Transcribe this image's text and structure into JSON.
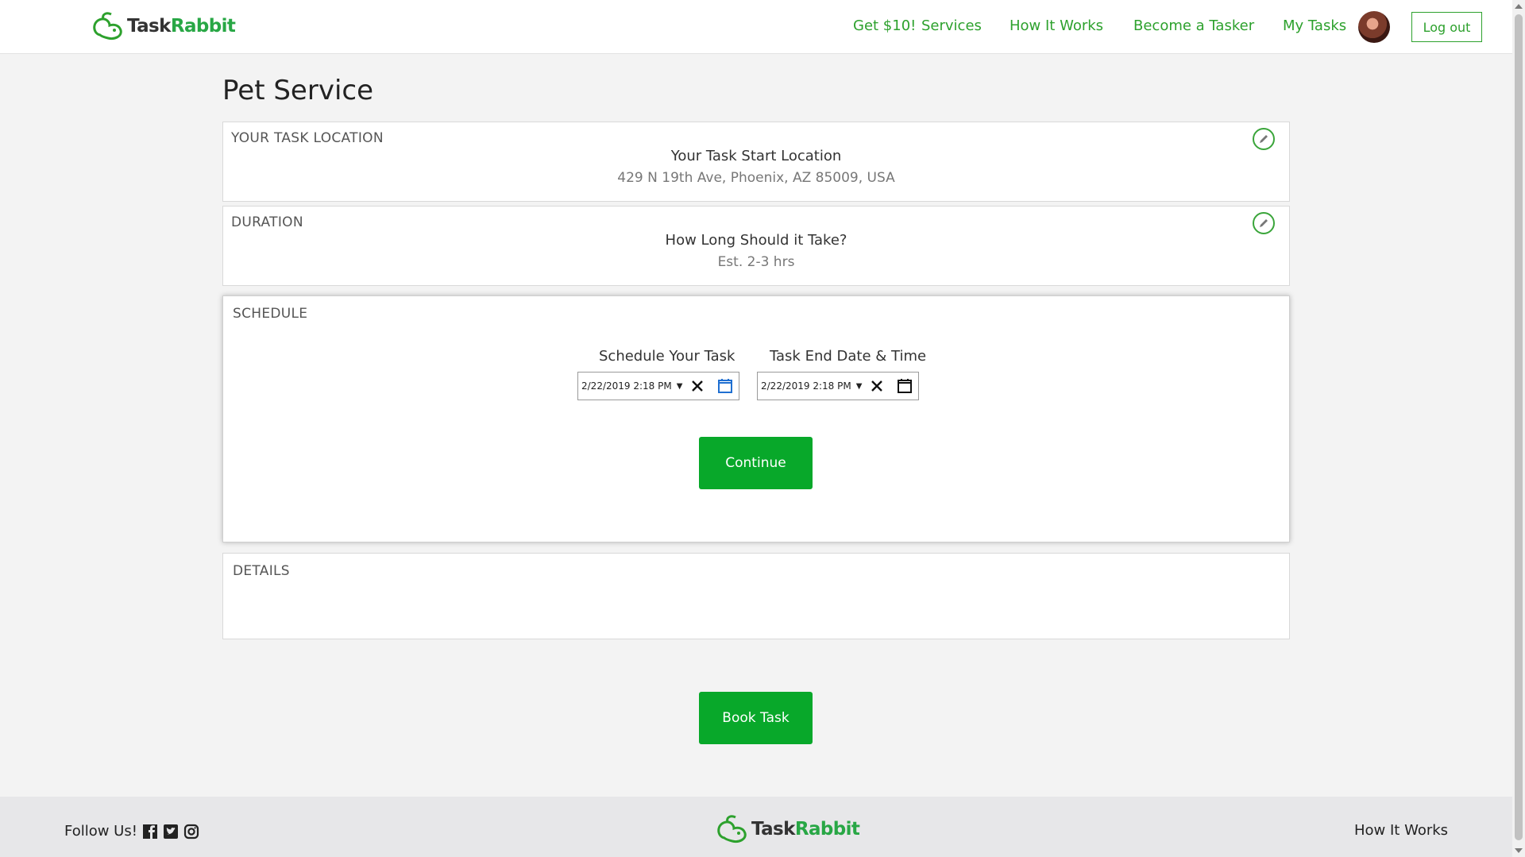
{
  "header": {
    "logo": {
      "text_part1": "Task",
      "text_part2": "Rabbit",
      "icon": "rabbit-logo-icon"
    },
    "nav": {
      "promo": "Get $10!",
      "services": "Services",
      "how_it_works": "How It Works",
      "become_tasker": "Become a Tasker",
      "my_tasks": "My Tasks"
    },
    "logout_label": "Log out"
  },
  "page": {
    "title": "Pet Service"
  },
  "location": {
    "label": "YOUR TASK LOCATION",
    "heading": "Your Task Start Location",
    "address": "429 N 19th Ave, Phoenix, AZ 85009, USA",
    "edit_icon": "pencil-icon"
  },
  "duration": {
    "label": "DURATION",
    "heading": "How Long Should it Take?",
    "estimate": "Est. 2-3 hrs",
    "edit_icon": "pencil-icon"
  },
  "schedule": {
    "label": "SCHEDULE",
    "start_label": "Schedule Your Task",
    "start_value": "2/22/2019 2:18  PM",
    "end_label": "Task End Date & Time",
    "end_value": "2/22/2019 2:18  PM",
    "dropdown_glyph": "▼",
    "continue_label": "Continue"
  },
  "details": {
    "label": "DETAILS"
  },
  "book_label": "Book Task",
  "footer": {
    "follow_label": "Follow Us!",
    "social_icons": [
      "facebook-icon",
      "twitter-icon",
      "instagram-icon"
    ],
    "how_it_works": "How It Works"
  },
  "colors": {
    "brand_green": "#2da12d",
    "button_green": "#08a82a",
    "footer_bg": "#e7e7e9"
  }
}
